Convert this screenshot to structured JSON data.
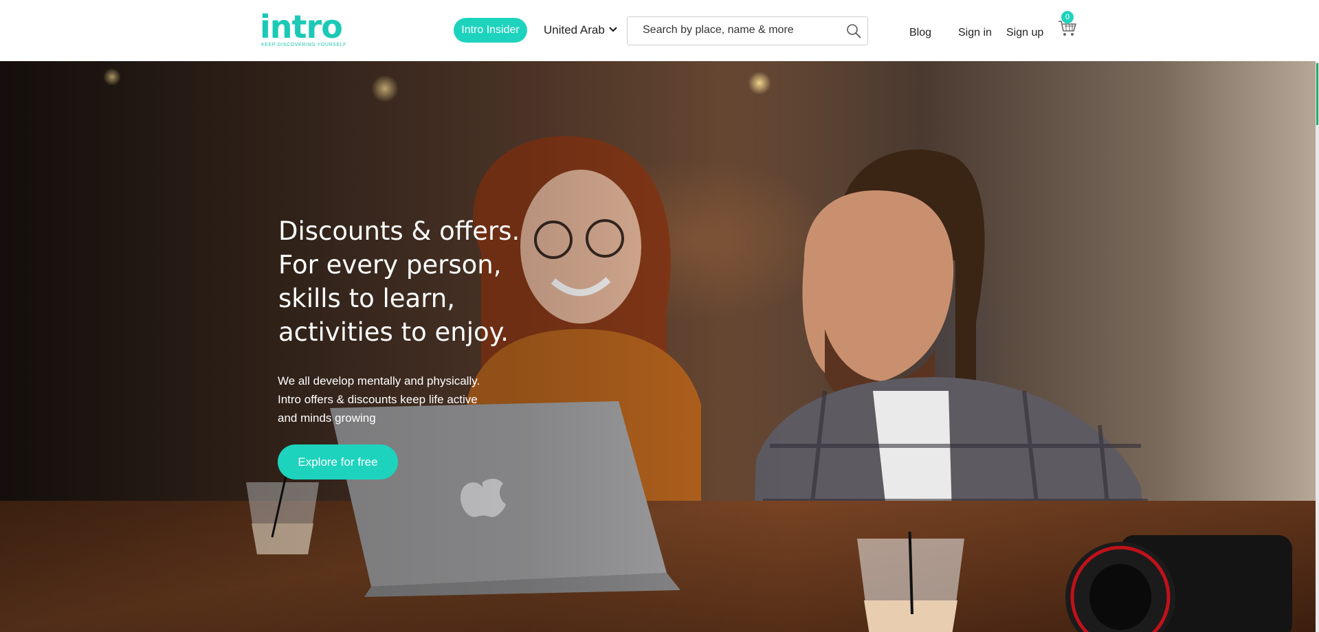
{
  "header": {
    "logo_text": "intro",
    "logo_tagline": "KEEP DISCOVERING YOURSELF",
    "insider_label": "Intro Insider",
    "country": {
      "selected": "United Arab Emirates"
    },
    "search": {
      "placeholder": "Search by place, name & more",
      "value": ""
    },
    "links": {
      "blog": "Blog",
      "sign_in": "Sign in",
      "sign_up": "Sign up"
    },
    "cart_count": "0"
  },
  "hero": {
    "title_lines": [
      "Discounts & offers.",
      "For every person,",
      "skills to learn,",
      "activities to enjoy."
    ],
    "description_lines": [
      "We all develop mentally and physically.",
      "Intro offers & discounts keep life active",
      "and minds growing"
    ],
    "cta_label": "Explore for free"
  },
  "colors": {
    "accent": "#1ed3bd",
    "nav_text": "#222222",
    "hero_text": "#ffffff"
  },
  "icons": [
    "search-icon",
    "chevron-down-icon",
    "cart-icon"
  ]
}
